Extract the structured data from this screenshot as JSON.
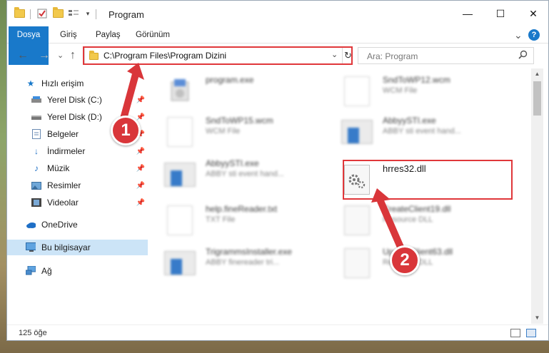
{
  "window": {
    "title": "Program",
    "minimize": "—",
    "maximize": "☐",
    "close": "✕"
  },
  "ribbon": {
    "tabs": [
      "Dosya",
      "Giriş",
      "Paylaş",
      "Görünüm"
    ],
    "collapse": "⌄",
    "help": "?"
  },
  "nav": {
    "back": "←",
    "forward": "→",
    "recent": "⌄",
    "up": "↑"
  },
  "address": {
    "path": "C:\\Program Files\\Program Dizini",
    "dropdown": "⌄",
    "refresh": "↻"
  },
  "search": {
    "placeholder": "Ara: Program",
    "icon": "search-icon"
  },
  "sidebar": {
    "items": [
      {
        "label": "Hızlı erişim",
        "icon": "star-icon",
        "pinned": false
      },
      {
        "label": "Yerel Disk (C:)",
        "icon": "drive-icon",
        "pinned": true
      },
      {
        "label": "Yerel Disk (D:)",
        "icon": "drive-icon",
        "pinned": true
      },
      {
        "label": "Belgeler",
        "icon": "documents-icon",
        "pinned": true
      },
      {
        "label": "İndirmeler",
        "icon": "download-icon",
        "pinned": true
      },
      {
        "label": "Müzik",
        "icon": "music-icon",
        "pinned": true
      },
      {
        "label": "Resimler",
        "icon": "pictures-icon",
        "pinned": true
      },
      {
        "label": "Videolar",
        "icon": "videos-icon",
        "pinned": true
      },
      {
        "label": "OneDrive",
        "icon": "cloud-icon",
        "pinned": false
      },
      {
        "label": "Bu bilgisayar",
        "icon": "computer-icon",
        "pinned": false,
        "selected": true
      },
      {
        "label": "Ağ",
        "icon": "network-icon",
        "pinned": false
      }
    ]
  },
  "files": [
    {
      "name": "program.exe",
      "type": "",
      "kind": "exe"
    },
    {
      "name": "SndToWP12.wcm",
      "type": "WCM File",
      "kind": "doc"
    },
    {
      "name": "SndToWP15.wcm",
      "type": "WCM File",
      "kind": "doc"
    },
    {
      "name": "AbbyySTI.exe",
      "type": "ABBY sti event hand...",
      "kind": "exe"
    },
    {
      "name": "AbbyySTI.exe",
      "type": "ABBY sti event hand...",
      "kind": "exe"
    },
    {
      "name": "hrres32.dll",
      "type": "",
      "kind": "dll"
    },
    {
      "name": "help.fineReader.txt",
      "type": "TXT File",
      "kind": "doc"
    },
    {
      "name": "CreateClient19.dll",
      "type": "Resource DLL",
      "kind": "dll"
    },
    {
      "name": "TrigrammsInstaller.exe",
      "type": "ABBY finereader tri...",
      "kind": "exe"
    },
    {
      "name": "UpdateClient63.dll",
      "type": "Resource DLL",
      "kind": "dll"
    }
  ],
  "status": {
    "count": "125 öğe"
  },
  "callouts": {
    "one": "1",
    "two": "2"
  },
  "colors": {
    "accent": "#1979ca",
    "highlight": "#e0373a",
    "selected": "#cce4f7"
  }
}
